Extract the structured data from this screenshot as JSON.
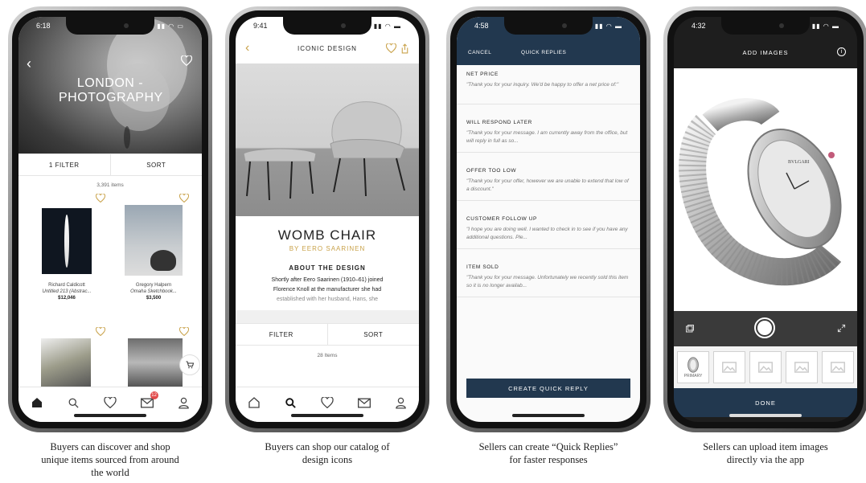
{
  "phones": [
    {
      "status_time": "6:18",
      "hero_title": "LONDON - PHOTOGRAPHY",
      "filter_label": "1 FILTER",
      "sort_label": "SORT",
      "items_count": "3,391 items",
      "items": [
        {
          "artist": "Richard Caldicott",
          "title": "Untitled 213 (Abstrac...",
          "price": "$12,046"
        },
        {
          "artist": "Gregory Halpern",
          "title": "Omaha Sketchbook...",
          "price": "$3,500"
        }
      ],
      "badge": "12",
      "tabs": [
        "home-icon",
        "search-icon",
        "heart-icon",
        "inbox-icon",
        "profile-icon"
      ],
      "caption": [
        "Buyers can discover and shop",
        "unique items sourced from around",
        "the world"
      ]
    },
    {
      "status_time": "9:41",
      "nav_title": "ICONIC DESIGN",
      "product_title": "WOMB CHAIR",
      "byline": "BY EERO SAARINEN",
      "about_heading": "ABOUT THE DESIGN",
      "desc_line1": "Shortly after Eero Saarinen (1910–61) joined",
      "desc_line2": "Florence Knoll at the manufacturer she had",
      "desc_line3": "established with her husband, Hans, she",
      "filter_label": "FILTER",
      "sort_label": "SORT",
      "items_count": "28 Items",
      "caption": [
        "Buyers can shop our catalog of",
        "design icons"
      ]
    },
    {
      "status_time": "4:58",
      "cancel_label": "CANCEL",
      "nav_title": "QUICK REPLIES",
      "replies": [
        {
          "title": "NET PRICE",
          "text": "\"Thank you for your inquiry. We'd be happy to offer a net price of:\""
        },
        {
          "title": "WILL RESPOND LATER",
          "text": "\"Thank you for your message. I am currently away from the office, but will reply in full as so..."
        },
        {
          "title": "OFFER TOO LOW",
          "text": "\"Thank you for your offer, however we are unable to extend that low of a discount.\""
        },
        {
          "title": "CUSTOMER FOLLOW UP",
          "text": "\"I hope you are doing well. I wanted to check in to see if you have any additional questions. Ple..."
        },
        {
          "title": "ITEM SOLD",
          "text": "\"Thank you for your message. Unfortunately we recently sold this item so it is no longer availab..."
        }
      ],
      "create_label": "CREATE QUICK REPLY",
      "caption": [
        "Sellers can create “Quick Replies”",
        "for faster responses"
      ]
    },
    {
      "status_time": "4:32",
      "nav_title": "ADD IMAGES",
      "info_label": "i",
      "watch_brand": "BVLGARI",
      "thumb_label": "PRIMARY",
      "done_label": "DONE",
      "caption": [
        "Sellers can upload item images",
        "directly via the app"
      ]
    }
  ],
  "colors": {
    "navy": "#22384f",
    "gold": "#c9a24a",
    "badge": "#e24b4b"
  }
}
